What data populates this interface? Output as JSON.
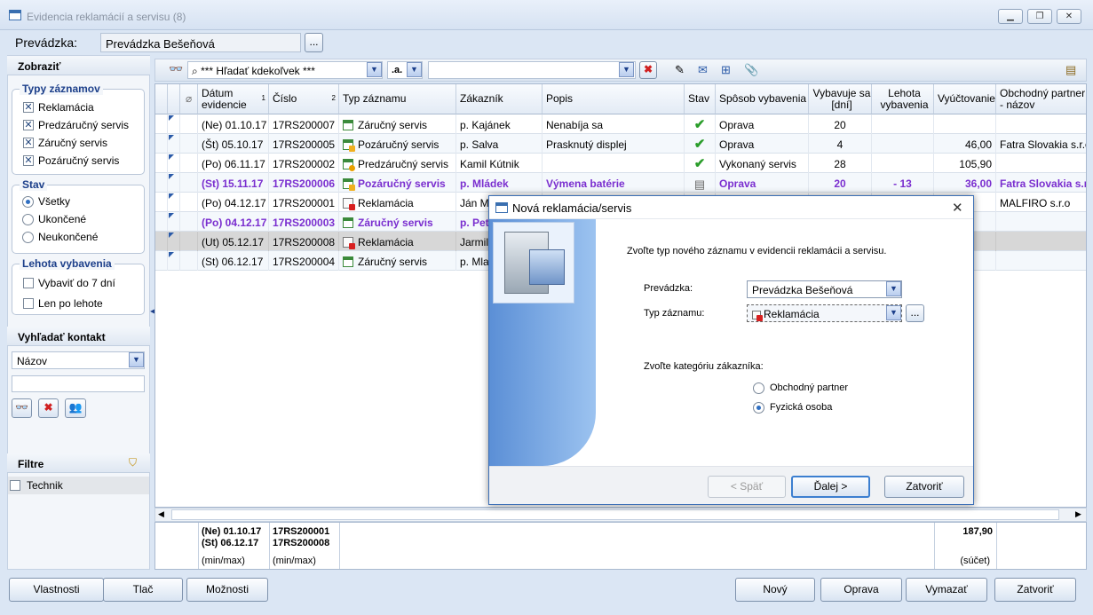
{
  "window": {
    "title": "Evidencia reklamácií a servisu (8)",
    "controls": [
      "minimize-icon",
      "restore-icon",
      "close-icon"
    ]
  },
  "topbar": {
    "prevadzka_label": "Prevádzka:",
    "prevadzka_value": "Prevádzka Bešeňová",
    "ellipsis": "..."
  },
  "left": {
    "zobrazit": "Zobraziť",
    "typy_title": "Typy záznamov",
    "typy": [
      {
        "label": "Reklamácia",
        "checked": true
      },
      {
        "label": "Predzáručný servis",
        "checked": true
      },
      {
        "label": "Záručný servis",
        "checked": true
      },
      {
        "label": "Pozáručný servis",
        "checked": true
      }
    ],
    "stav_title": "Stav",
    "stav": [
      {
        "label": "Všetky",
        "selected": true
      },
      {
        "label": "Ukončené",
        "selected": false
      },
      {
        "label": "Neukončené",
        "selected": false
      }
    ],
    "lehota_title": "Lehota vybavenia",
    "lehota": [
      {
        "label": "Vybaviť do 7 dní",
        "checked": false
      },
      {
        "label": "Len po lehote",
        "checked": false
      }
    ],
    "vyhladat_title": "Vyhľadať kontakt",
    "vyhladat_select": "Názov",
    "vyhladat_input": "",
    "filtre_title": "Filtre",
    "filtre": [
      {
        "label": "Technik",
        "checked": false
      }
    ]
  },
  "toolbar": {
    "search_text": "*** Hľadať kdekoľvek ***",
    "mode": ".a.",
    "filter_value": ""
  },
  "grid": {
    "headers": [
      "Dátum evidencie",
      "Číslo",
      "Typ záznamu",
      "Zákazník",
      "Popis",
      "Stav",
      "Spôsob vybavenia",
      "Vybavuje sa [dní]",
      "Lehota vybavenia",
      "Vyúčtovanie",
      "Obchodný partner - názov"
    ],
    "sort_markers": [
      "1",
      "2"
    ],
    "rows": [
      {
        "date": "(Ne) 01.10.17",
        "num": "17RS200007",
        "type": "Záručný servis",
        "icon": "g",
        "cust": "p. Kajánek",
        "desc": "Nenabíja sa",
        "state": "check",
        "way": "Oprava",
        "days": "20",
        "lehota": "",
        "amount": "",
        "partner": "",
        "style": ""
      },
      {
        "date": "(Št) 05.10.17",
        "num": "17RS200005",
        "type": "Pozáručný servis",
        "icon": "o",
        "cust": "p. Salva",
        "desc": "Prasknutý displej",
        "state": "check",
        "way": "Oprava",
        "days": "4",
        "lehota": "",
        "amount": "46,00",
        "partner": "Fatra Slovakia s.r.o",
        "style": "alt"
      },
      {
        "date": "(Po) 06.11.17",
        "num": "17RS200002",
        "type": "Predzáručný servis",
        "icon": "y",
        "cust": "Kamil Kútnik",
        "desc": "",
        "state": "check",
        "way": "Vykonaný servis",
        "days": "28",
        "lehota": "",
        "amount": "105,90",
        "partner": "",
        "style": ""
      },
      {
        "date": "(St) 15.11.17",
        "num": "17RS200006",
        "type": "Pozáručný servis",
        "icon": "o",
        "cust": "p. Mládek",
        "desc": "Výmena batérie",
        "state": "doc",
        "way": "Oprava",
        "days": "20",
        "lehota": "-   13",
        "amount": "36,00",
        "partner": "Fatra Slovakia s.r.o",
        "style": "alt purple"
      },
      {
        "date": "(Po) 04.12.17",
        "num": "17RS200001",
        "type": "Reklamácia",
        "icon": "r",
        "cust": "Ján Ma",
        "desc": "",
        "state": "",
        "way": "",
        "days": "",
        "lehota": "",
        "amount": "",
        "partner": "MALFIRO s.r.o",
        "style": ""
      },
      {
        "date": "(Po) 04.12.17",
        "num": "17RS200003",
        "type": "Záručný servis",
        "icon": "g",
        "cust": "p. Pete",
        "desc": "",
        "state": "",
        "way": "",
        "days": "",
        "lehota": "",
        "amount": "",
        "partner": "",
        "style": "alt purple"
      },
      {
        "date": "(Ut) 05.12.17",
        "num": "17RS200008",
        "type": "Reklamácia",
        "icon": "r",
        "cust": "Jarmila",
        "desc": "",
        "state": "",
        "way": "",
        "days": "",
        "lehota": "",
        "amount": "",
        "partner": "",
        "style": "sel"
      },
      {
        "date": "(St) 06.12.17",
        "num": "17RS200004",
        "type": "Záručný servis",
        "icon": "g",
        "cust": "p. Mlat",
        "desc": "",
        "state": "",
        "way": "",
        "days": "",
        "lehota": "",
        "amount": "",
        "partner": "",
        "style": "alt"
      }
    ]
  },
  "footer": {
    "date_min": "(Ne) 01.10.17",
    "date_max": "(St) 06.12.17",
    "num_min": "17RS200001",
    "num_max": "17RS200008",
    "minmax": "(min/max)",
    "minmax2": "(min/max)",
    "sum": "187,90",
    "sum_label": "(súčet)"
  },
  "bottom": {
    "vlastnosti": "Vlastnosti",
    "tlac": "Tlač",
    "moznosti": "Možnosti",
    "novy": "Nový",
    "oprava": "Oprava",
    "vymazat": "Vymazať",
    "zatvorit": "Zatvoriť"
  },
  "dialog": {
    "title": "Nová reklamácia/servis",
    "intro": "Zvoľte typ nového záznamu v evidencii reklamácii a servisu.",
    "prevadzka_label": "Prevádzka:",
    "prevadzka_value": "Prevádzka Bešeňová",
    "typ_label": "Typ záznamu:",
    "typ_value": "Reklamácia",
    "ellipsis": "...",
    "kategoria_label": "Zvoľte kategóriu zákazníka:",
    "options": [
      {
        "label": "Obchodný partner",
        "selected": false
      },
      {
        "label": "Fyzická osoba",
        "selected": true
      }
    ],
    "back": "< Späť",
    "next": "Ďalej >",
    "close": "Zatvoriť"
  }
}
